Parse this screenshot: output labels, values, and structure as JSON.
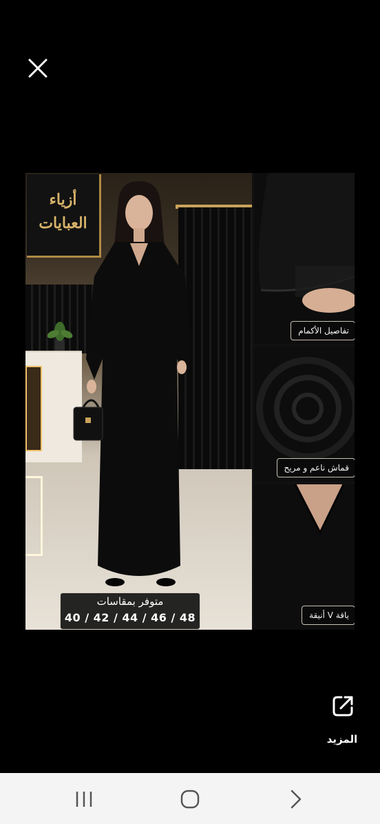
{
  "viewer": {
    "close_icon": "close-icon"
  },
  "ad_image": {
    "store_sign": "أزياء العبايات",
    "sizes": {
      "title": "متوفر بمقاسات",
      "values": "40 / 42 / 44 / 46 / 48"
    },
    "details": [
      {
        "label": "تفاصيل الأكمام"
      },
      {
        "label": "قماش ناعم و مريح"
      },
      {
        "label": "ياقة V أنيقة"
      }
    ]
  },
  "actions": {
    "share_icon": "external-link-icon",
    "more_label": "المزيد"
  },
  "navbar": {
    "recent_icon": "recent-apps-icon",
    "home_icon": "home-icon",
    "back_icon": "back-chevron-icon"
  },
  "colors": {
    "background": "#000000",
    "navbar": "#f4f4f4",
    "accent_gold": "#d8b46a"
  }
}
